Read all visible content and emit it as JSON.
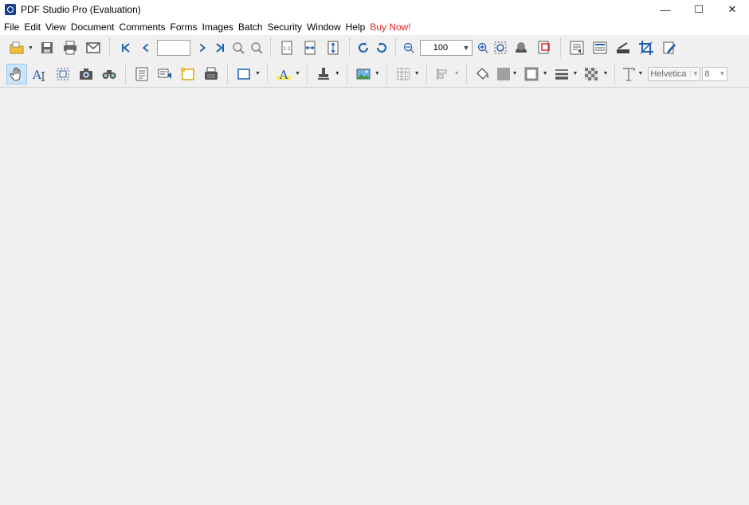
{
  "window": {
    "title": "PDF Studio Pro (Evaluation)",
    "controls": [
      "—",
      "☐",
      "✕"
    ]
  },
  "menu": [
    "File",
    "Edit",
    "View",
    "Document",
    "Comments",
    "Forms",
    "Images",
    "Batch",
    "Security",
    "Window",
    "Help"
  ],
  "menu_buy": "Buy Now!",
  "toolbar": {
    "page_number": "",
    "zoom_value": "100",
    "font_name": "Helvetica",
    "font_size": "8"
  }
}
